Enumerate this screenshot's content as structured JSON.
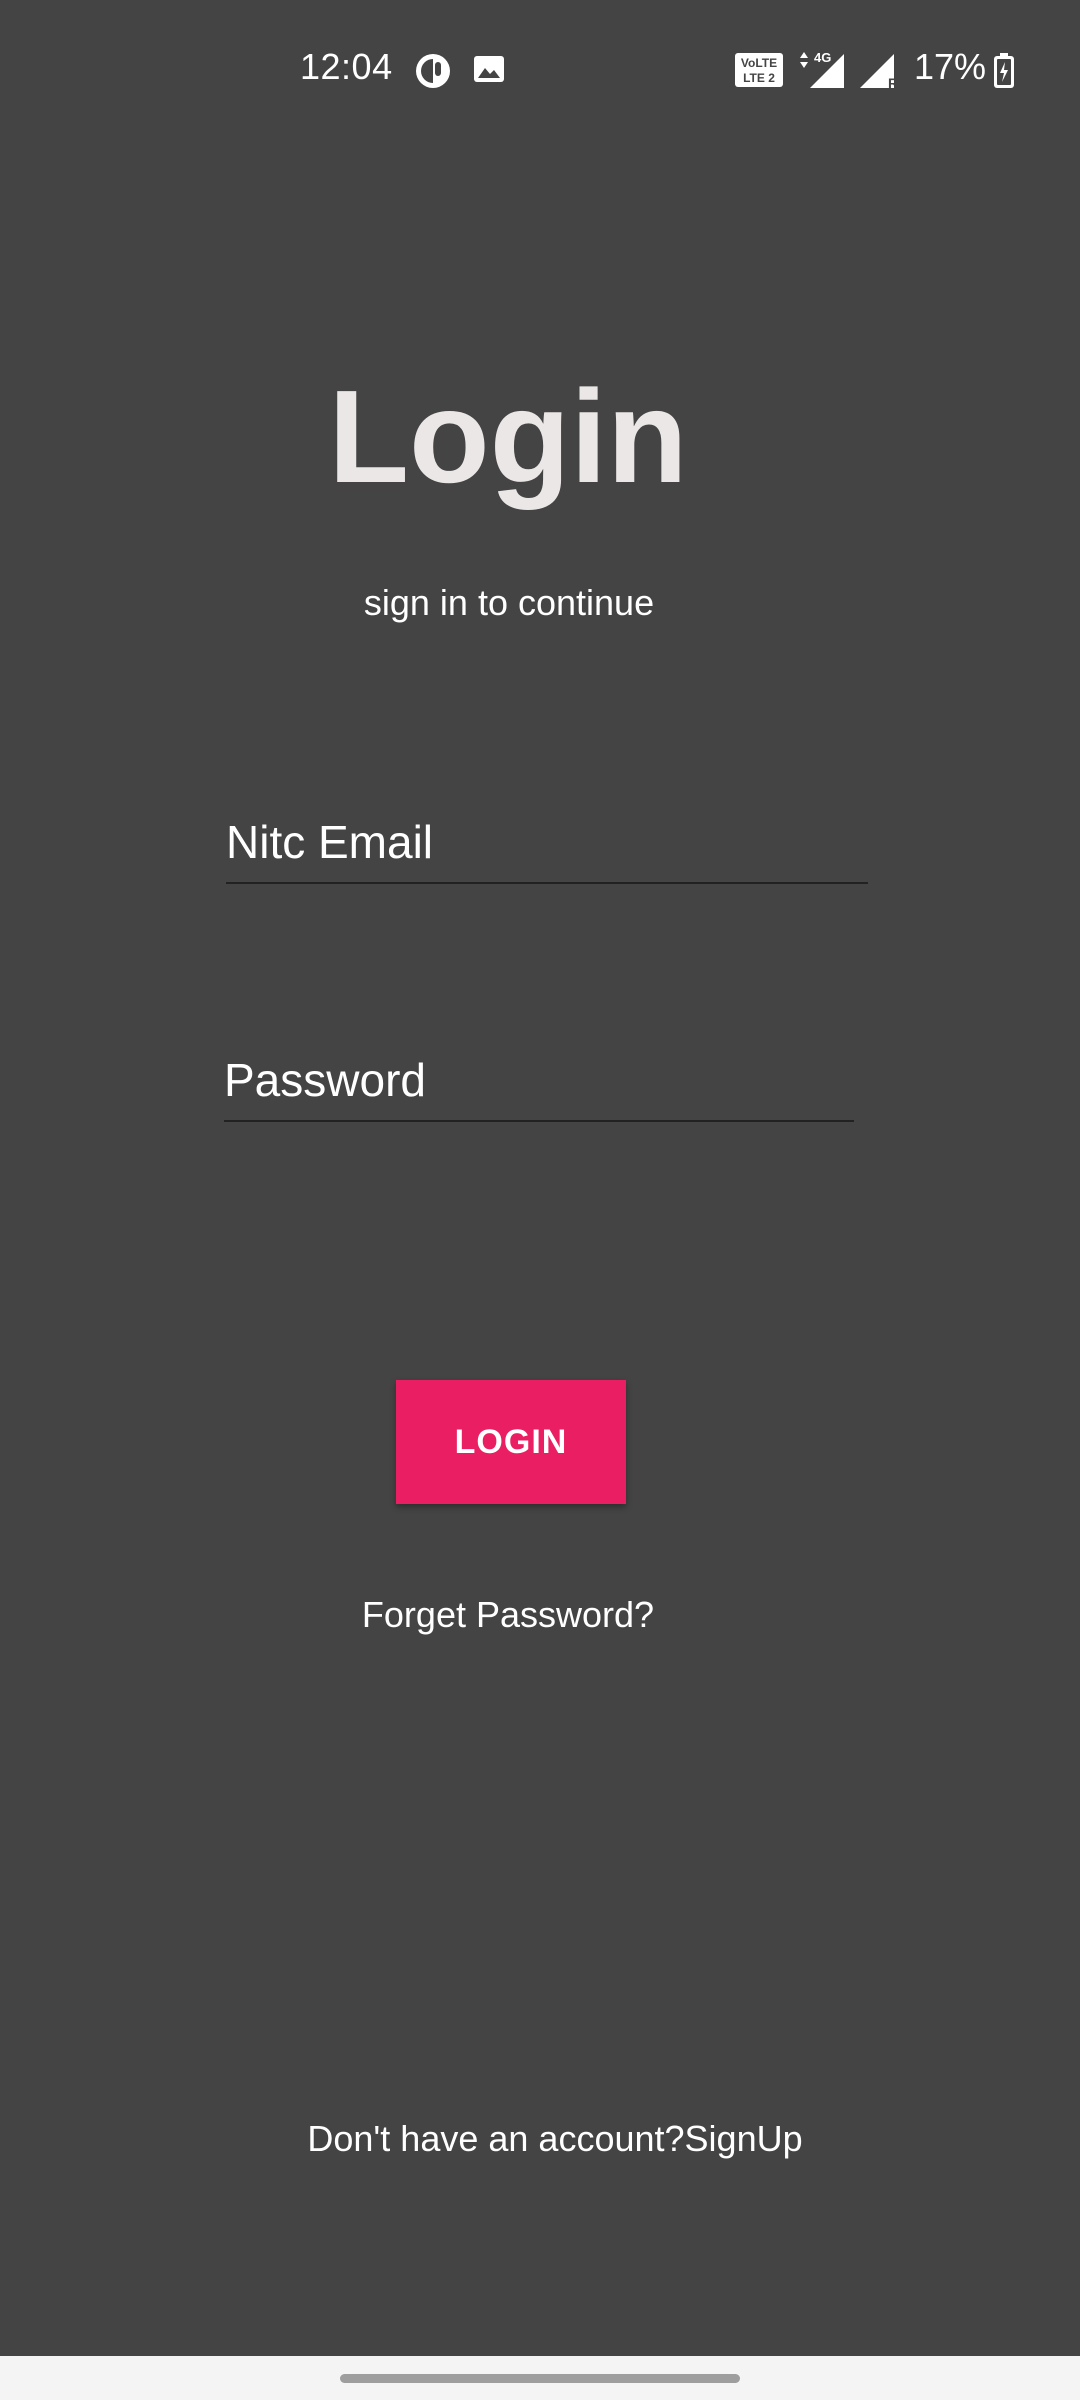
{
  "status_bar": {
    "time": "12:04",
    "icons": [
      "data-saver-icon",
      "gallery-icon",
      "volte-icon",
      "4g-signal-icon",
      "signal-roaming-icon",
      "battery-icon"
    ],
    "battery_percent": "17%",
    "network_label": "4G",
    "volte_label": "VoLTE 2"
  },
  "login": {
    "title": "Login",
    "subtitle": "sign in to continue",
    "email_placeholder": "Nitc Email",
    "password_placeholder": "Password",
    "button_label": "LOGIN",
    "forgot_password": "Forget Password?",
    "signup_prompt": "Don't have an account?",
    "signup_link": "SignUp"
  },
  "colors": {
    "background": "#444444",
    "accent": "#e91e63",
    "title_text": "#ece7e7",
    "nav_bar": "#f4f4f4"
  }
}
